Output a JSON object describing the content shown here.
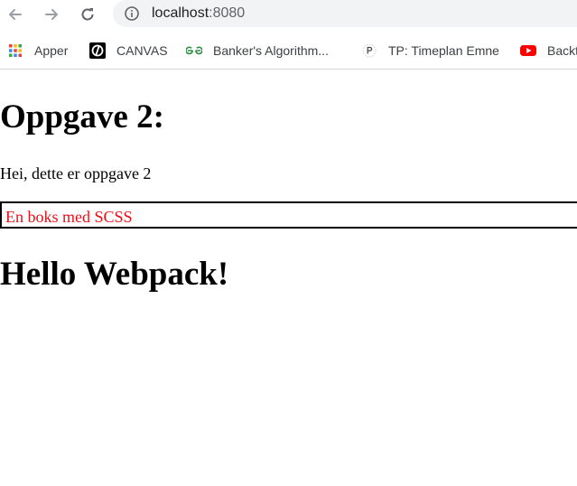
{
  "browser": {
    "url_host": "localhost",
    "url_port": ":8080",
    "bookmarks": [
      {
        "label": "Apper",
        "icon": "apps-grid-icon"
      },
      {
        "label": "CANVAS",
        "icon": "canvas-logo-icon"
      },
      {
        "label": "Banker's Algorithm...",
        "icon": "geeksforgeeks-icon"
      },
      {
        "label": "TP: Timeplan Emne",
        "icon": "tp-icon"
      },
      {
        "label": "Backt",
        "icon": "youtube-icon"
      }
    ],
    "colors": {
      "omnibox_bg": "#f1f3f4",
      "youtube_red": "#ff0000",
      "gfg_green": "#2f8d46"
    }
  },
  "page": {
    "heading": "Oppgave 2:",
    "paragraph": "Hei, dette er oppgave 2",
    "scss_box_text": "En boks med SCSS",
    "webpack_heading": "Hello Webpack!",
    "colors": {
      "scss_text": "#e8101a",
      "box_border": "#000000"
    }
  }
}
